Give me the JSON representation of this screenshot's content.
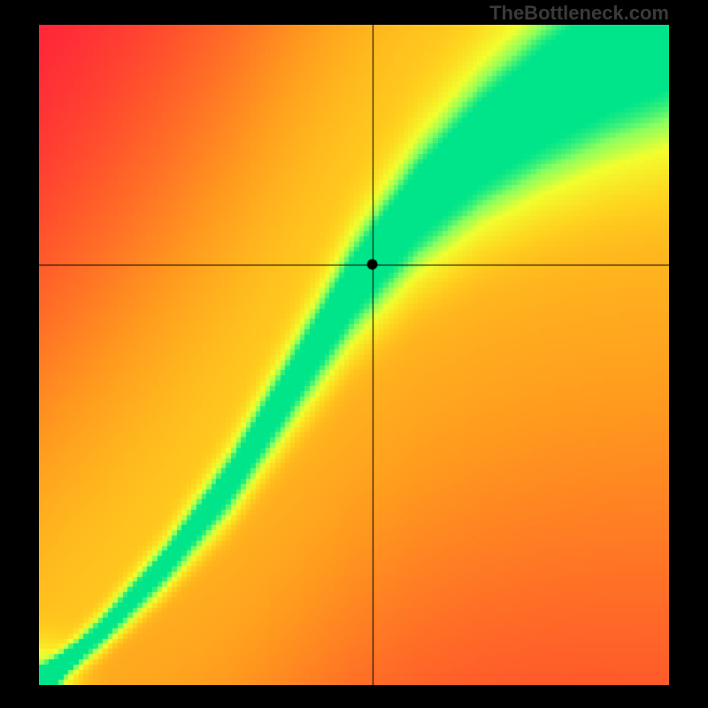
{
  "watermark": "TheBottleneck.com",
  "chart_data": {
    "type": "heatmap",
    "title": "",
    "xlabel": "",
    "ylabel": "",
    "xlim": [
      0,
      1
    ],
    "ylim": [
      0,
      1
    ],
    "crosshair": {
      "x": 0.529,
      "y": 0.637
    },
    "marker": {
      "x": 0.529,
      "y": 0.637,
      "radius": 6,
      "color": "#000000"
    },
    "optimal_curve_description": "Green ridge indicating balanced CPU/GPU pairing; starts near origin, rises roughly linearly then bends toward steeper slope approaching upper-right.",
    "optimal_curve_samples": [
      {
        "x": 0.0,
        "y": 0.0
      },
      {
        "x": 0.1,
        "y": 0.08
      },
      {
        "x": 0.2,
        "y": 0.18
      },
      {
        "x": 0.3,
        "y": 0.3
      },
      {
        "x": 0.4,
        "y": 0.45
      },
      {
        "x": 0.5,
        "y": 0.6
      },
      {
        "x": 0.6,
        "y": 0.72
      },
      {
        "x": 0.7,
        "y": 0.81
      },
      {
        "x": 0.8,
        "y": 0.88
      },
      {
        "x": 0.9,
        "y": 0.94
      },
      {
        "x": 1.0,
        "y": 0.99
      }
    ],
    "ridge_halfwidth_samples": [
      {
        "x": 0.0,
        "hw": 0.01
      },
      {
        "x": 0.2,
        "hw": 0.02
      },
      {
        "x": 0.4,
        "hw": 0.035
      },
      {
        "x": 0.6,
        "hw": 0.055
      },
      {
        "x": 0.8,
        "hw": 0.075
      },
      {
        "x": 1.0,
        "hw": 0.095
      }
    ],
    "color_stops": [
      {
        "t": 0.0,
        "color": "#ff163d"
      },
      {
        "t": 0.2,
        "color": "#ff5a2a"
      },
      {
        "t": 0.4,
        "color": "#ff9a1e"
      },
      {
        "t": 0.6,
        "color": "#ffd21e"
      },
      {
        "t": 0.8,
        "color": "#f2ff2e"
      },
      {
        "t": 0.92,
        "color": "#8cff5e"
      },
      {
        "t": 1.0,
        "color": "#00e58a"
      }
    ],
    "grid": false,
    "pixelated": true,
    "resolution": 128
  }
}
